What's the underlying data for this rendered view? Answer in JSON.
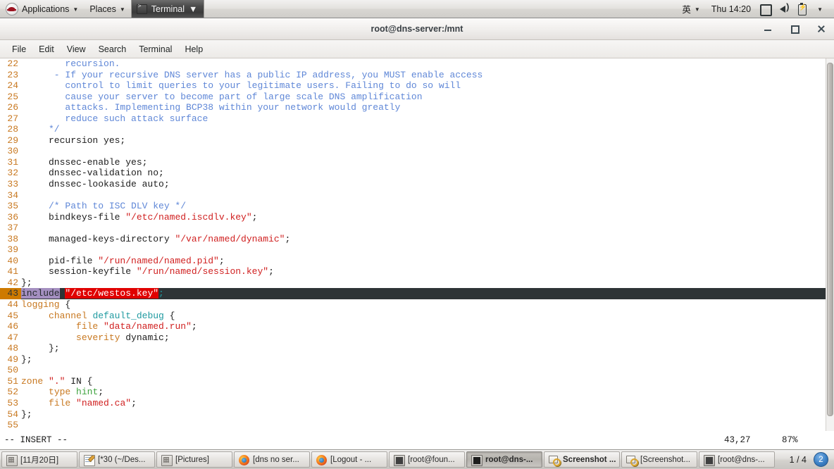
{
  "top_panel": {
    "logo_icon": "redhat-logo-icon",
    "applications_label": "Applications",
    "places_label": "Places",
    "window_entry_label": "Terminal",
    "window_entry_icon": "terminal-icon",
    "caret_icon": "caret-down-icon",
    "language_indicator": "英",
    "clock": "Thu 14:20",
    "display_icon": "display-icon",
    "volume_icon": "volume-icon",
    "battery_icon": "battery-icon"
  },
  "window": {
    "title": "root@dns-server:/mnt",
    "minimize_icon": "minimize-icon",
    "maximize_icon": "maximize-icon",
    "close_icon": "close-icon",
    "menus": [
      "File",
      "Edit",
      "View",
      "Search",
      "Terminal",
      "Help"
    ]
  },
  "editor": {
    "lines": [
      {
        "num": "22",
        "segments": [
          {
            "text": "        recursion.",
            "cls": "c-comment"
          }
        ]
      },
      {
        "num": "23",
        "segments": [
          {
            "text": "      - If your recursive DNS server has a public IP address, you MUST enable access",
            "cls": "c-comment"
          }
        ]
      },
      {
        "num": "24",
        "segments": [
          {
            "text": "        control to limit queries to your legitimate users. Failing to do so will",
            "cls": "c-comment"
          }
        ]
      },
      {
        "num": "25",
        "segments": [
          {
            "text": "        cause your server to become part of large scale DNS amplification",
            "cls": "c-comment"
          }
        ]
      },
      {
        "num": "26",
        "segments": [
          {
            "text": "        attacks. Implementing BCP38 within your network would greatly",
            "cls": "c-comment"
          }
        ]
      },
      {
        "num": "27",
        "segments": [
          {
            "text": "        reduce such attack surface",
            "cls": "c-comment"
          }
        ]
      },
      {
        "num": "28",
        "segments": [
          {
            "text": "     */",
            "cls": "c-comment"
          }
        ]
      },
      {
        "num": "29",
        "segments": [
          {
            "text": "     recursion yes;",
            "cls": "c-plain"
          }
        ]
      },
      {
        "num": "30",
        "segments": [
          {
            "text": "",
            "cls": "c-plain"
          }
        ]
      },
      {
        "num": "31",
        "segments": [
          {
            "text": "     dnssec-enable yes;",
            "cls": "c-plain"
          }
        ]
      },
      {
        "num": "32",
        "segments": [
          {
            "text": "     dnssec-validation no;",
            "cls": "c-plain"
          }
        ]
      },
      {
        "num": "33",
        "segments": [
          {
            "text": "     dnssec-lookaside auto;",
            "cls": "c-plain"
          }
        ]
      },
      {
        "num": "34",
        "segments": [
          {
            "text": "",
            "cls": "c-plain"
          }
        ]
      },
      {
        "num": "35",
        "segments": [
          {
            "text": "     /* Path to ISC DLV key */",
            "cls": "c-comment"
          }
        ]
      },
      {
        "num": "36",
        "segments": [
          {
            "text": "     bindkeys-file ",
            "cls": "c-plain"
          },
          {
            "text": "\"/etc/named.iscdlv.key\"",
            "cls": "c-str"
          },
          {
            "text": ";",
            "cls": "c-punc"
          }
        ]
      },
      {
        "num": "37",
        "segments": [
          {
            "text": "",
            "cls": "c-plain"
          }
        ]
      },
      {
        "num": "38",
        "segments": [
          {
            "text": "     managed-keys-directory ",
            "cls": "c-plain"
          },
          {
            "text": "\"/var/named/dynamic\"",
            "cls": "c-str"
          },
          {
            "text": ";",
            "cls": "c-punc"
          }
        ]
      },
      {
        "num": "39",
        "segments": [
          {
            "text": "",
            "cls": "c-plain"
          }
        ]
      },
      {
        "num": "40",
        "segments": [
          {
            "text": "     pid-file ",
            "cls": "c-plain"
          },
          {
            "text": "\"/run/named/named.pid\"",
            "cls": "c-str"
          },
          {
            "text": ";",
            "cls": "c-punc"
          }
        ]
      },
      {
        "num": "41",
        "segments": [
          {
            "text": "     session-keyfile ",
            "cls": "c-plain"
          },
          {
            "text": "\"/run/named/session.key\"",
            "cls": "c-str"
          },
          {
            "text": ";",
            "cls": "c-punc"
          }
        ]
      },
      {
        "num": "42",
        "segments": [
          {
            "text": "};",
            "cls": "c-plain"
          }
        ]
      },
      {
        "num": "43",
        "cursor": true,
        "segments": [
          {
            "text": "include",
            "cls": "hl-include"
          },
          {
            "text": " ",
            "cls": "hl-gap"
          },
          {
            "text": "\"/etc/westos.key\"",
            "cls": "hl-str"
          },
          {
            "text": ";",
            "cls": "hl-semi"
          }
        ]
      },
      {
        "num": "44",
        "segments": [
          {
            "text": "logging",
            "cls": "c-key"
          },
          {
            "text": " {",
            "cls": "c-punc"
          }
        ]
      },
      {
        "num": "45",
        "segments": [
          {
            "text": "     ",
            "cls": "c-plain"
          },
          {
            "text": "channel",
            "cls": "c-key"
          },
          {
            "text": " ",
            "cls": "c-plain"
          },
          {
            "text": "default_debug",
            "cls": "c-type"
          },
          {
            "text": " {",
            "cls": "c-punc"
          }
        ]
      },
      {
        "num": "46",
        "segments": [
          {
            "text": "          ",
            "cls": "c-plain"
          },
          {
            "text": "file",
            "cls": "c-key"
          },
          {
            "text": " ",
            "cls": "c-plain"
          },
          {
            "text": "\"data/named.run\"",
            "cls": "c-str"
          },
          {
            "text": ";",
            "cls": "c-punc"
          }
        ]
      },
      {
        "num": "47",
        "segments": [
          {
            "text": "          ",
            "cls": "c-plain"
          },
          {
            "text": "severity",
            "cls": "c-key"
          },
          {
            "text": " dynamic;",
            "cls": "c-plain"
          }
        ]
      },
      {
        "num": "48",
        "segments": [
          {
            "text": "     };",
            "cls": "c-plain"
          }
        ]
      },
      {
        "num": "49",
        "segments": [
          {
            "text": "};",
            "cls": "c-plain"
          }
        ]
      },
      {
        "num": "50",
        "segments": [
          {
            "text": "",
            "cls": "c-plain"
          }
        ]
      },
      {
        "num": "51",
        "segments": [
          {
            "text": "zone",
            "cls": "c-key"
          },
          {
            "text": " ",
            "cls": "c-plain"
          },
          {
            "text": "\".\"",
            "cls": "c-str"
          },
          {
            "text": " IN {",
            "cls": "c-plain"
          }
        ]
      },
      {
        "num": "52",
        "segments": [
          {
            "text": "     ",
            "cls": "c-plain"
          },
          {
            "text": "type",
            "cls": "c-key"
          },
          {
            "text": " ",
            "cls": "c-plain"
          },
          {
            "text": "hint",
            "cls": "c-const"
          },
          {
            "text": ";",
            "cls": "c-punc"
          }
        ]
      },
      {
        "num": "53",
        "segments": [
          {
            "text": "     ",
            "cls": "c-plain"
          },
          {
            "text": "file",
            "cls": "c-key"
          },
          {
            "text": " ",
            "cls": "c-plain"
          },
          {
            "text": "\"named.ca\"",
            "cls": "c-str"
          },
          {
            "text": ";",
            "cls": "c-punc"
          }
        ]
      },
      {
        "num": "54",
        "segments": [
          {
            "text": "};",
            "cls": "c-plain"
          }
        ]
      },
      {
        "num": "55",
        "segments": [
          {
            "text": "",
            "cls": "c-plain"
          }
        ]
      }
    ],
    "status": {
      "mode": "-- INSERT --",
      "position": "43,27",
      "percent": "87%"
    },
    "scrollbar_name": "terminal-scrollbar"
  },
  "taskbar": {
    "items": [
      {
        "label": "[11月20日]",
        "icon": "archive-icon",
        "active": false,
        "bold": false
      },
      {
        "label": "[*30 (~/Des...",
        "icon": "notepad-icon",
        "active": false,
        "bold": false
      },
      {
        "label": "[Pictures]",
        "icon": "archive-icon",
        "active": false,
        "bold": false
      },
      {
        "label": "[dns no ser...",
        "icon": "firefox-icon",
        "active": false,
        "bold": false
      },
      {
        "label": "[Logout - ...",
        "icon": "firefox-icon",
        "active": false,
        "bold": false
      },
      {
        "label": "[root@foun...",
        "icon": "terminal-icon",
        "active": false,
        "bold": false
      },
      {
        "label": "root@dns-...",
        "icon": "terminal-icon",
        "active": true,
        "bold": true
      },
      {
        "label": "Screenshot ...",
        "icon": "screenshot-icon",
        "active": false,
        "bold": true
      },
      {
        "label": "[Screenshot...",
        "icon": "screenshot-icon",
        "active": false,
        "bold": false
      },
      {
        "label": "[root@dns-...",
        "icon": "terminal-icon",
        "active": false,
        "bold": false
      }
    ],
    "pager_count": "1 / 4",
    "pager_badge": "2"
  },
  "colors": {
    "cursor_line_bg": "#2e3436",
    "line_number": "#c87820",
    "comment": "#5f87d7",
    "string": "#d02020",
    "keyword": "#c87820",
    "type": "#1f9aa0",
    "constant": "#3fa33f",
    "search_highlight": "#e00000",
    "include_highlight": "#a48fc0"
  }
}
